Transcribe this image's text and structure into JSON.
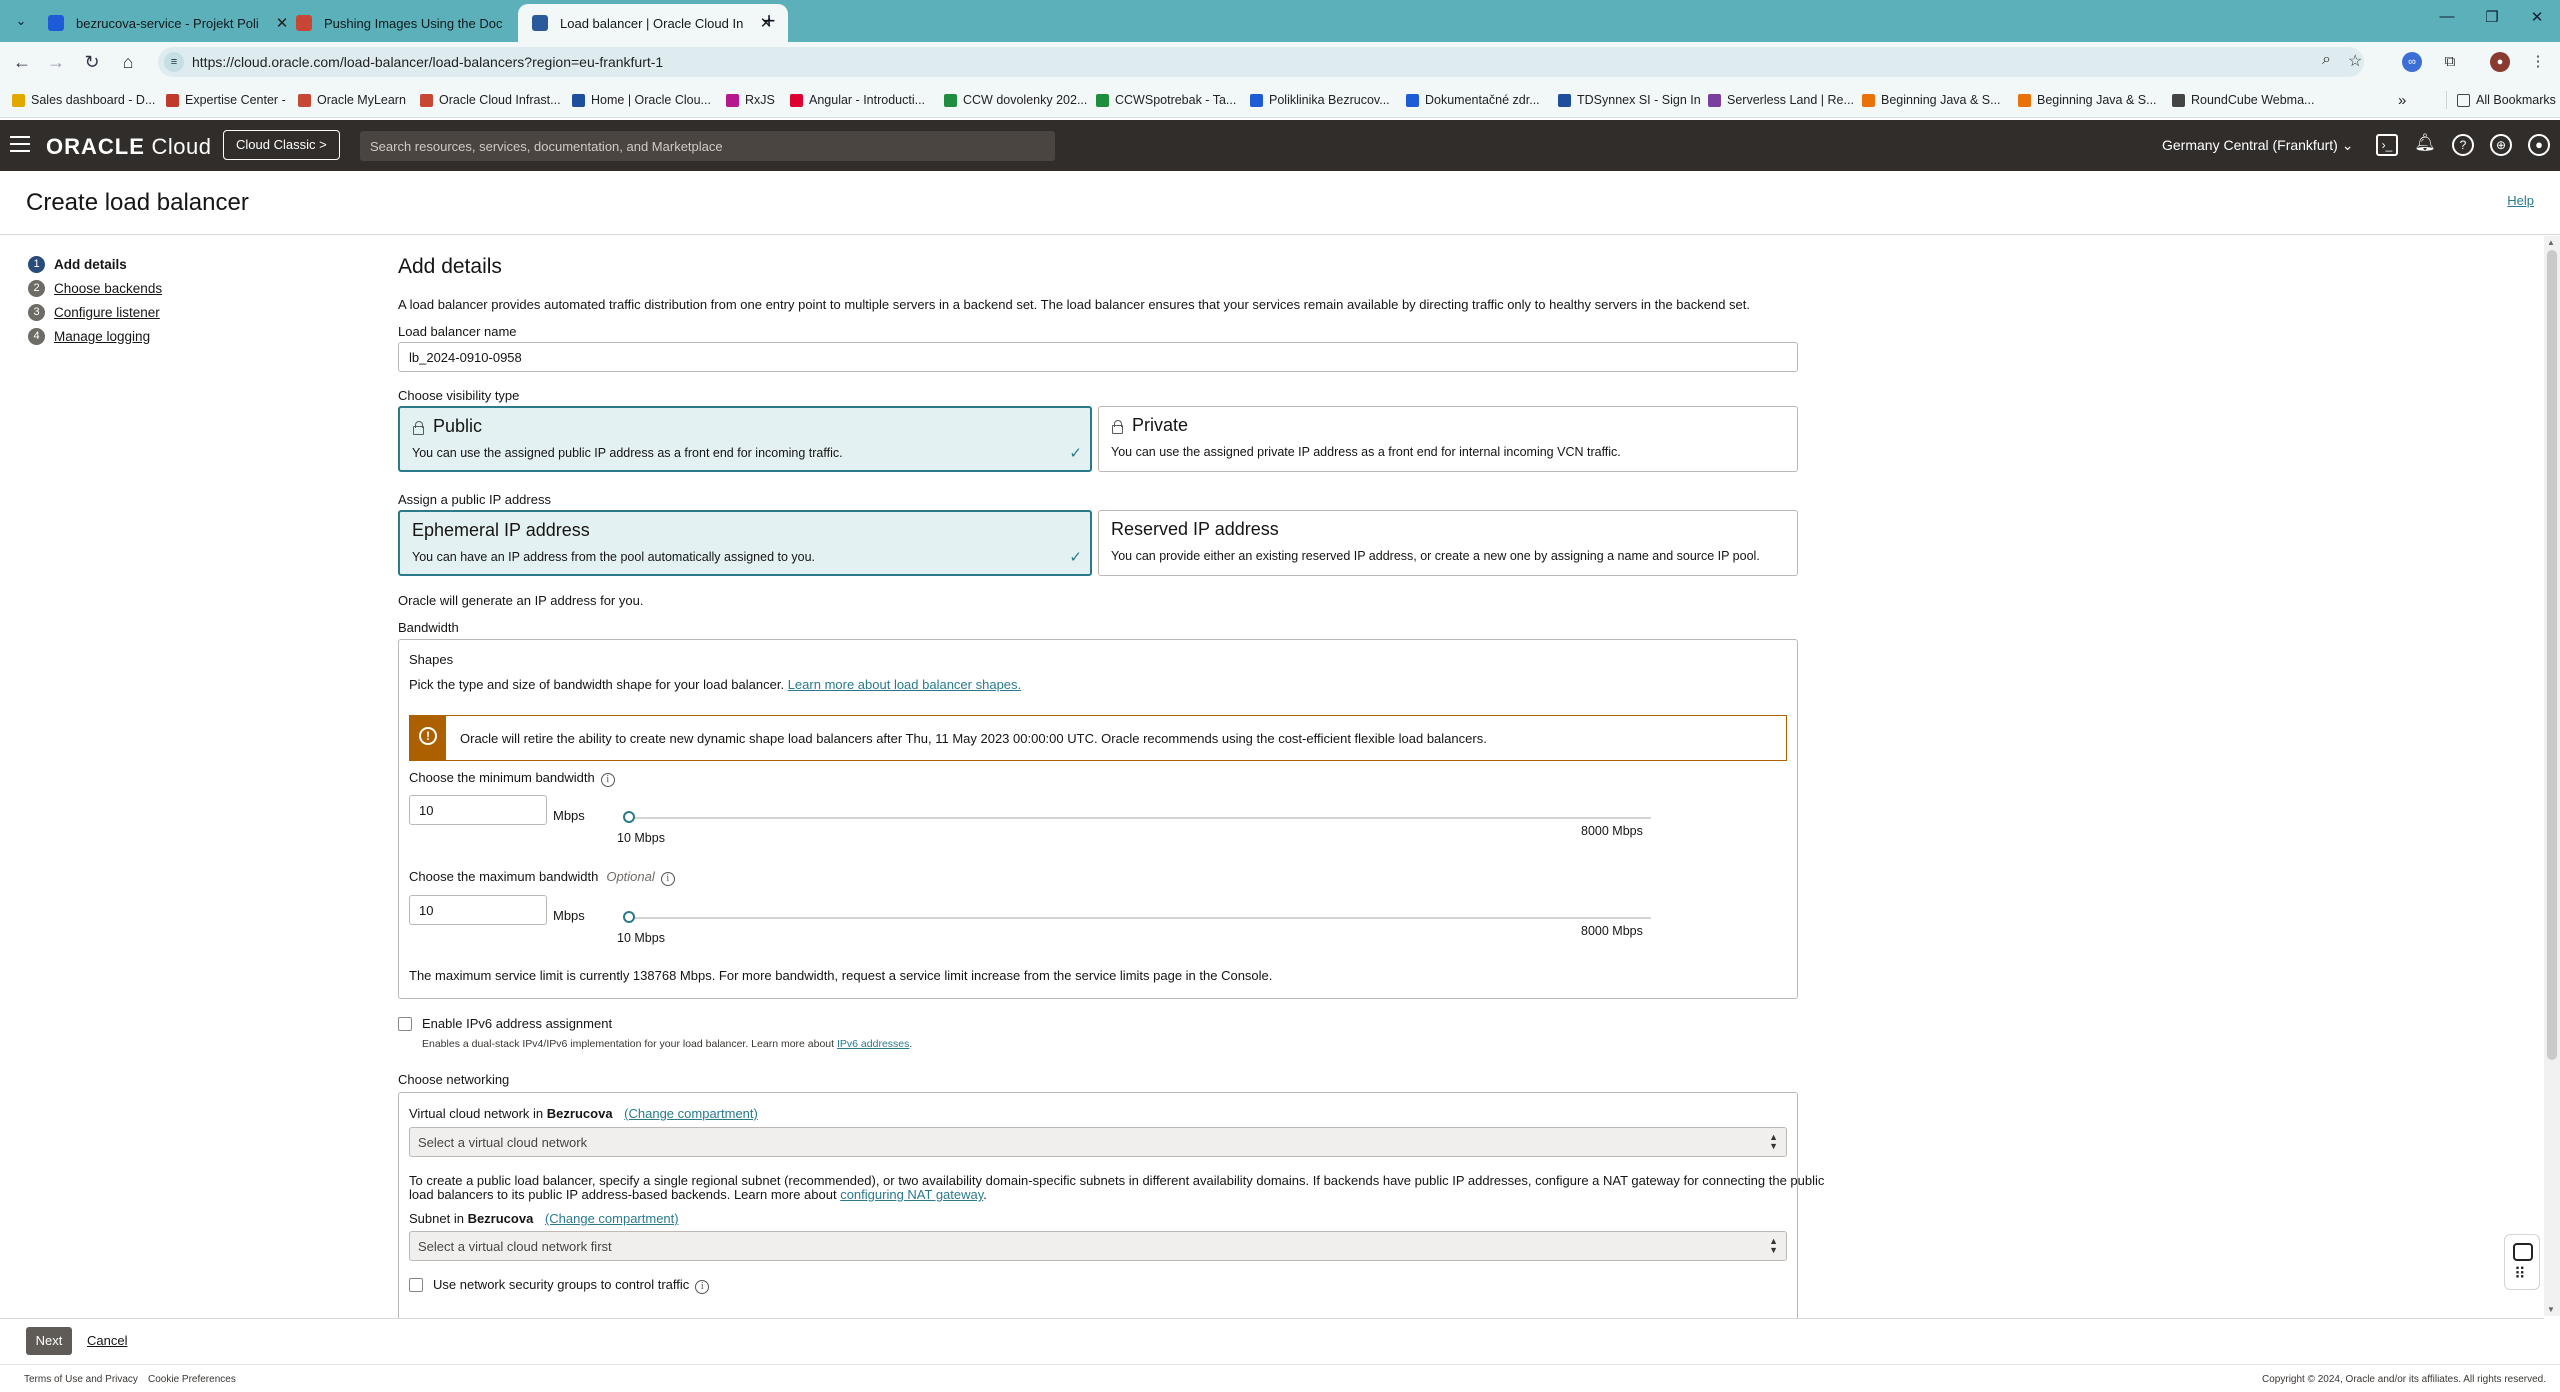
{
  "browser": {
    "tabs": [
      {
        "title": "bezrucova-service - Projekt Poli",
        "favcolor": "#1e5bd6",
        "active": false
      },
      {
        "title": "Pushing Images Using the Doc",
        "favcolor": "#c74634",
        "active": false
      },
      {
        "title": "Load balancer | Oracle Cloud In",
        "favcolor": "#2a5a9c",
        "active": true
      }
    ],
    "url": "https://cloud.oracle.com/load-balancer/load-balancers?region=eu-frankfurt-1",
    "bookmarks": [
      {
        "label": "Sales dashboard - D...",
        "color": "#e0a800"
      },
      {
        "label": "Expertise Center -",
        "color": "#c0392b"
      },
      {
        "label": "Oracle MyLearn",
        "color": "#c74634"
      },
      {
        "label": "Oracle Cloud Infrast...",
        "color": "#c74634"
      },
      {
        "label": "Home | Oracle Clou...",
        "color": "#1f4e9a"
      },
      {
        "label": "RxJS",
        "color": "#b7178c"
      },
      {
        "label": "Angular - Introducti...",
        "color": "#dd0031"
      },
      {
        "label": "CCW dovolenky 202...",
        "color": "#1e8e3e"
      },
      {
        "label": "CCWSpotrebak - Ta...",
        "color": "#1e8e3e"
      },
      {
        "label": "Poliklinika Bezrucov...",
        "color": "#1e5bd6"
      },
      {
        "label": "Dokumentačné zdr...",
        "color": "#1e5bd6"
      },
      {
        "label": "TDSynnex SI - Sign In",
        "color": "#1f4e9a"
      },
      {
        "label": "Serverless Land | Re...",
        "color": "#7b3fa0"
      },
      {
        "label": "Beginning Java & S...",
        "color": "#e8710a"
      },
      {
        "label": "Beginning Java & S...",
        "color": "#e8710a"
      },
      {
        "label": "RoundCube Webma...",
        "color": "#444444"
      }
    ],
    "all_bookmarks": "All Bookmarks"
  },
  "header": {
    "logo_bold": "ORACLE",
    "logo_rest": " Cloud",
    "cloud_classic": "Cloud Classic >",
    "search_placeholder": "Search resources, services, documentation, and Marketplace",
    "region": "Germany Central (Frankfurt)"
  },
  "page": {
    "title": "Create load balancer",
    "help": "Help"
  },
  "steps": [
    {
      "num": "1",
      "label": "Add details",
      "current": true
    },
    {
      "num": "2",
      "label": "Choose backends",
      "current": false
    },
    {
      "num": "3",
      "label": "Configure listener",
      "current": false
    },
    {
      "num": "4",
      "label": "Manage logging",
      "current": false
    }
  ],
  "form": {
    "heading": "Add details",
    "intro": "A load balancer provides automated traffic distribution from one entry point to multiple servers in a backend set. The load balancer ensures that your services remain available by directing traffic only to healthy servers in the backend set.",
    "name_label": "Load balancer name",
    "name_value": "lb_2024-0910-0958",
    "visibility_label": "Choose visibility type",
    "visibility": {
      "public_title": "Public",
      "public_desc": "You can use the assigned public IP address as a front end for incoming traffic.",
      "private_title": "Private",
      "private_desc": "You can use the assigned private IP address as a front end for internal incoming VCN traffic.",
      "selected": "public"
    },
    "ip_label": "Assign a public IP address",
    "ip": {
      "ephemeral_title": "Ephemeral IP address",
      "ephemeral_desc": "You can have an IP address from the pool automatically assigned to you.",
      "reserved_title": "Reserved IP address",
      "reserved_desc": "You can provide either an existing reserved IP address, or create a new one by assigning a name and source IP pool.",
      "selected": "ephemeral"
    },
    "oracle_generate": "Oracle will generate an IP address for you.",
    "bandwidth_label": "Bandwidth",
    "shapes": {
      "title": "Shapes",
      "desc": "Pick the type and size of bandwidth shape for your load balancer.",
      "link": "Learn more about load balancer shapes.",
      "warning": "Oracle will retire the ability to create new dynamic shape load balancers after Thu, 11 May 2023 00:00:00 UTC. Oracle recommends using the cost-efficient flexible load balancers.",
      "min_label": "Choose the minimum bandwidth",
      "min_value": "10",
      "max_label": "Choose the maximum bandwidth",
      "max_optional": "Optional",
      "max_value": "10",
      "unit": "Mbps",
      "slider_min": "10 Mbps",
      "slider_max": "8000 Mbps",
      "limit_text": "The maximum service limit is currently 138768 Mbps. For more bandwidth, request a service limit increase from the service limits page in the Console."
    },
    "ipv6": {
      "label": "Enable IPv6 address assignment",
      "help": "Enables a dual-stack IPv4/IPv6 implementation for your load balancer. Learn more about",
      "help_link": "IPv6 addresses",
      "help_end": "."
    },
    "networking": {
      "label": "Choose networking",
      "vcn_label": "Virtual cloud network in",
      "compartment": "Bezrucova",
      "change": "(Change compartment)",
      "vcn_placeholder": "Select a virtual cloud network",
      "note_line1": "To create a public load balancer, specify a single regional subnet (recommended), or two availability domain-specific subnets in different availability domains. If backends have public IP addresses, configure a NAT gateway for connecting the public",
      "note_line2": "load balancers to its public IP address-based backends. Learn more about",
      "note_link": "configuring NAT gateway",
      "note_end": ".",
      "subnet_label": "Subnet in",
      "subnet_placeholder": "Select a virtual cloud network first",
      "nsg_label": "Use network security groups to control traffic"
    }
  },
  "footer": {
    "next": "Next",
    "cancel": "Cancel",
    "terms": "Terms of Use and Privacy",
    "cookies": "Cookie Preferences",
    "copyright": "Copyright © 2024, Oracle and/or its affiliates. All rights reserved."
  }
}
